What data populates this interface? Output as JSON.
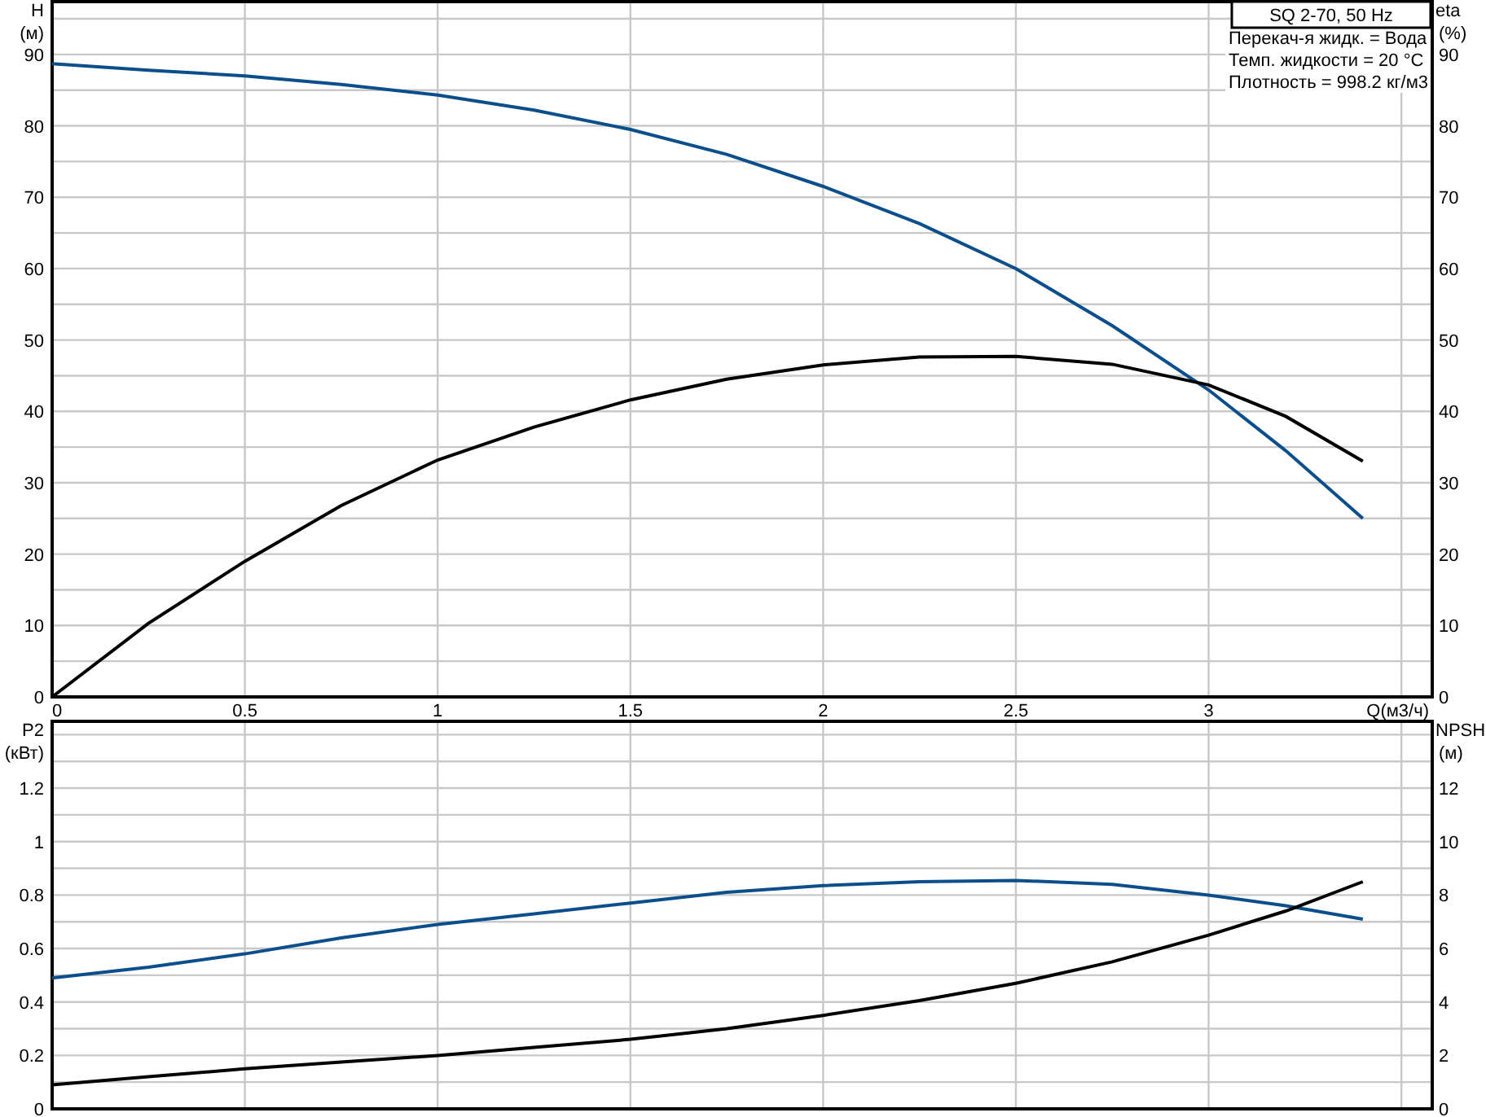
{
  "legend": {
    "title": "SQ 2-70, 50 Hz",
    "lines": [
      "Перекач-я жидк. = Вода",
      "Темп. жидкости = 20 °C",
      "Плотность = 998.2 кг/м3"
    ]
  },
  "head_chart": {
    "units": [
      "(м)",
      "(%)"
    ],
    "chart_data": {
      "type": "line",
      "xlabel": "Q(м3/ч)",
      "ylabel": "H",
      "y2label": "eta",
      "grid": true,
      "x": [
        0,
        0.25,
        0.5,
        0.75,
        1,
        1.25,
        1.5,
        1.75,
        2,
        2.25,
        2.5,
        2.75,
        3,
        3.2,
        3.4
      ],
      "series": [
        {
          "color": "#0a4f8c",
          "values": [
            88.7,
            87.8,
            87,
            85.8,
            84.3,
            82.2,
            79.5,
            76,
            71.5,
            66.3,
            60,
            52,
            43,
            34.5,
            25
          ]
        },
        {
          "color": "#000000",
          "values": [
            0,
            10.3,
            19,
            26.8,
            33.2,
            37.8,
            41.6,
            44.5,
            46.5,
            47.6,
            47.7,
            46.6,
            43.7,
            39.3,
            33
          ]
        }
      ],
      "xlim": [
        0,
        3.58
      ],
      "ylim": [
        0,
        97.4
      ],
      "y2lim": [
        0,
        97.4
      ],
      "xticks": [
        0,
        0.5,
        1,
        1.5,
        2,
        2.5,
        3
      ],
      "yticks": [
        0,
        10,
        20,
        30,
        40,
        50,
        60,
        70,
        80,
        90
      ],
      "y2ticks": [
        0,
        10,
        20,
        30,
        40,
        50,
        60,
        70,
        80,
        90
      ]
    }
  },
  "power_chart": {
    "units": [
      "(кВт)",
      "(м)"
    ],
    "chart_data": {
      "type": "line",
      "ylabel": "P2",
      "y2label": "NPSH",
      "grid": true,
      "x": [
        0,
        0.25,
        0.5,
        0.75,
        1,
        1.25,
        1.5,
        1.75,
        2,
        2.25,
        2.5,
        2.75,
        3,
        3.2,
        3.4
      ],
      "series": [
        {
          "color": "#0a4f8c",
          "values": [
            0.49,
            0.53,
            0.58,
            0.64,
            0.69,
            0.73,
            0.77,
            0.81,
            0.835,
            0.85,
            0.855,
            0.84,
            0.8,
            0.76,
            0.71
          ]
        },
        {
          "color": "#000000",
          "axis": "y2",
          "values": [
            0.9,
            1.2,
            1.5,
            1.75,
            2.0,
            2.3,
            2.6,
            3.0,
            3.5,
            4.05,
            4.7,
            5.5,
            6.5,
            7.4,
            8.5
          ]
        }
      ],
      "xlim": [
        0,
        3.58
      ],
      "ylim": [
        0,
        1.45
      ],
      "y2lim": [
        0,
        14.5
      ],
      "yticks": [
        0,
        0.2,
        0.4,
        0.6,
        0.8,
        1,
        1.2
      ],
      "y2ticks": [
        0,
        2,
        4,
        6,
        8,
        10,
        12
      ]
    }
  }
}
